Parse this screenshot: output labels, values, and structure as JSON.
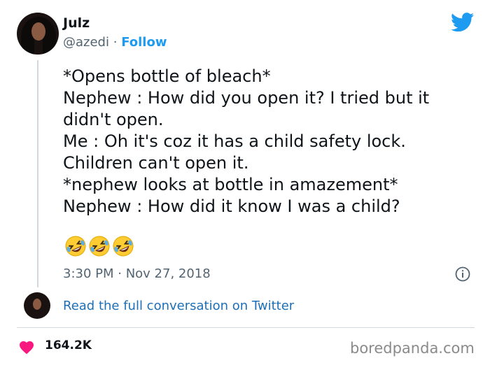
{
  "author": {
    "name": "Julz",
    "handle": "@azedi",
    "separator": "·",
    "follow_label": "Follow"
  },
  "tweet": {
    "lines": [
      "*Opens bottle of bleach*",
      "Nephew : How did you open it? I tried but it",
      "didn't open.",
      "Me : Oh it's coz it has a child safety lock.",
      "Children can't open it.",
      "*nephew looks at bottle in amazement*",
      "Nephew : How did it know I was a child?"
    ],
    "emojis": [
      "rolling-on-floor-laughing",
      "rolling-on-floor-laughing",
      "rolling-on-floor-laughing"
    ],
    "timestamp": "3:30 PM · Nov 27, 2018"
  },
  "conversation_link": "Read the full conversation on Twitter",
  "likes": "164.2K",
  "watermark": "boredpanda.com",
  "colors": {
    "twitter_blue": "#1d9bf0",
    "link_blue": "#1d6fb8",
    "heart_pink": "#f91880",
    "secondary_text": "#536471"
  }
}
